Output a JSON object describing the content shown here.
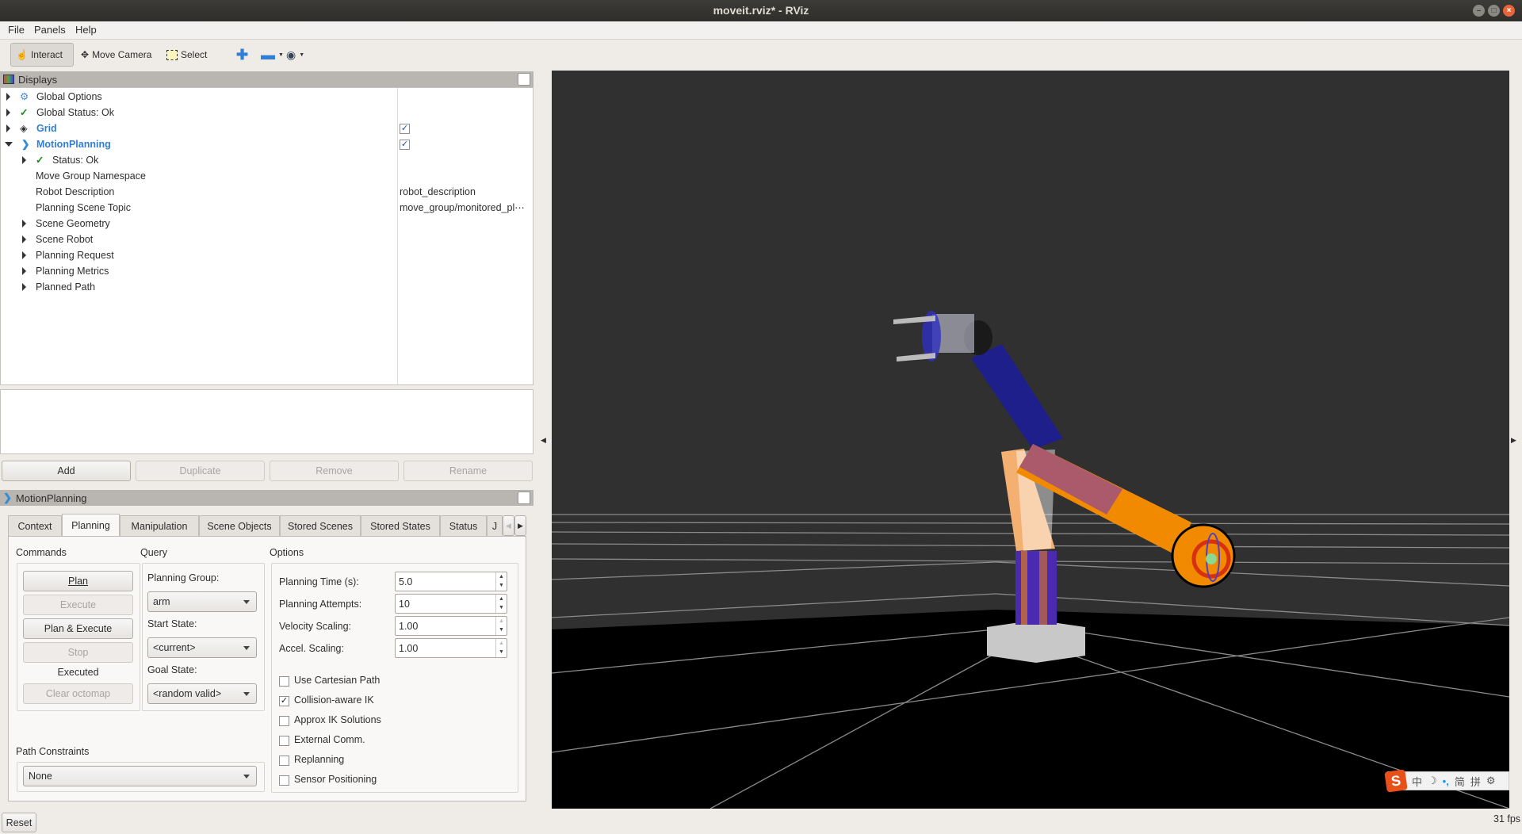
{
  "window": {
    "title": "moveit.rviz* - RViz"
  },
  "menu": {
    "items": [
      "File",
      "Panels",
      "Help"
    ]
  },
  "toolbar": {
    "interact": "Interact",
    "move_camera": "Move Camera",
    "select": "Select"
  },
  "displays": {
    "title": "Displays",
    "tree": [
      {
        "label": "Global Options",
        "icon": "gear-icon",
        "value": ""
      },
      {
        "label": "Global Status: Ok",
        "icon": "check-icon",
        "value": ""
      },
      {
        "label": "Grid",
        "icon": "grid-icon",
        "checked": true
      },
      {
        "label": "MotionPlanning",
        "icon": "motion-planning-icon",
        "checked": true,
        "expanded": true
      },
      {
        "label": "Status: Ok",
        "icon": "check-icon"
      },
      {
        "label": "Move Group Namespace",
        "value": ""
      },
      {
        "label": "Robot Description",
        "value": "robot_description"
      },
      {
        "label": "Planning Scene Topic",
        "value": "move_group/monitored_pl⋯"
      },
      {
        "label": "Scene Geometry"
      },
      {
        "label": "Scene Robot"
      },
      {
        "label": "Planning Request"
      },
      {
        "label": "Planning Metrics"
      },
      {
        "label": "Planned Path"
      }
    ],
    "buttons": {
      "add": "Add",
      "duplicate": "Duplicate",
      "remove": "Remove",
      "rename": "Rename"
    }
  },
  "motion_planning": {
    "title": "MotionPlanning",
    "tabs": [
      "Context",
      "Planning",
      "Manipulation",
      "Scene Objects",
      "Stored Scenes",
      "Stored States",
      "Status",
      "J"
    ],
    "active_tab": "Planning",
    "commands": {
      "title": "Commands",
      "plan": "Plan",
      "execute": "Execute",
      "plan_execute": "Plan & Execute",
      "stop": "Stop",
      "status": "Executed",
      "clear_octomap": "Clear octomap"
    },
    "query": {
      "title": "Query",
      "planning_group_label": "Planning Group:",
      "planning_group": "arm",
      "start_state_label": "Start State:",
      "start_state": "<current>",
      "goal_state_label": "Goal State:",
      "goal_state": "<random valid>"
    },
    "options": {
      "title": "Options",
      "planning_time_label": "Planning Time (s):",
      "planning_time": "5.0",
      "planning_attempts_label": "Planning Attempts:",
      "planning_attempts": "10",
      "velocity_scaling_label": "Velocity Scaling:",
      "velocity_scaling": "1.00",
      "accel_scaling_label": "Accel. Scaling:",
      "accel_scaling": "1.00",
      "checkboxes": [
        {
          "label": "Use Cartesian Path",
          "checked": false
        },
        {
          "label": "Collision-aware IK",
          "checked": true
        },
        {
          "label": "Approx IK Solutions",
          "checked": false
        },
        {
          "label": "External Comm.",
          "checked": false
        },
        {
          "label": "Replanning",
          "checked": false
        },
        {
          "label": "Sensor Positioning",
          "checked": false
        }
      ]
    },
    "path_constraints": {
      "title": "Path Constraints",
      "value": "None"
    }
  },
  "footer": {
    "reset": "Reset",
    "fps": "31 fps"
  },
  "ime": {
    "logo": "S",
    "items": [
      "中",
      "☽",
      "•,",
      "简",
      "拼",
      "⚙"
    ]
  },
  "colors": {
    "accent": "#2f7fd8",
    "robot_orange": "#f28a00",
    "robot_blue": "#1c1c9c",
    "floor": "#000000",
    "background": "#303030"
  }
}
